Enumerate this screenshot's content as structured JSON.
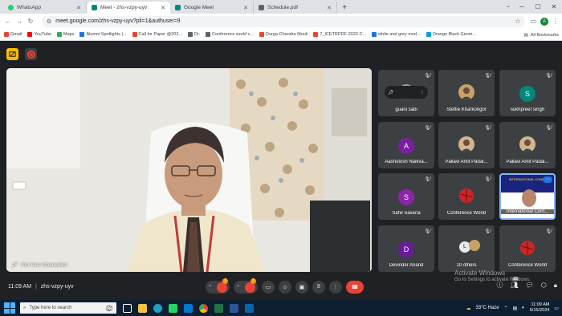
{
  "browser": {
    "tabs": [
      {
        "title": "WhatsApp",
        "color": "#25d366",
        "active": false
      },
      {
        "title": "Meet - zhs-vzpy-uyv",
        "color": "#00897b",
        "active": true
      },
      {
        "title": "Google Meet",
        "color": "#00897b",
        "active": false
      },
      {
        "title": "Schedule.pdf",
        "color": "#5f6368",
        "active": false
      }
    ],
    "new_tab": "+",
    "url": "meet.google.com/zhs-vzpy-uyv?pli=1&authuser=9",
    "bookmarks": [
      {
        "label": "Gmail",
        "color": "#ea4335"
      },
      {
        "label": "YouTube",
        "color": "#ff0000"
      },
      {
        "label": "Maps",
        "color": "#34a853"
      },
      {
        "label": "Alumni Spotlights |...",
        "color": "#1a73e8"
      },
      {
        "label": "Call for Paper @202...",
        "color": "#ea4335"
      },
      {
        "label": "Dr.",
        "color": "#5f6368"
      },
      {
        "label": "Conference world c...",
        "color": "#5f6368"
      },
      {
        "label": "Durga Chandra Mouli",
        "color": "#ea4335"
      },
      {
        "label": "7_ICETRPDF-2023 C...",
        "color": "#ea4335"
      },
      {
        "label": "white and grey mod...",
        "color": "#1a73e8"
      },
      {
        "label": "Orange Black Geom...",
        "color": "#00a3e0"
      }
    ],
    "all_bookmarks": "All Bookmarks"
  },
  "meet": {
    "main_speaker": {
      "name": "Pro Vice-Chancellor"
    },
    "tiles": [
      {
        "name": "guani sabi",
        "type": "photo",
        "color": "#9e9e9e",
        "pinned": true
      },
      {
        "name": "Steffie Kharkongor",
        "type": "photo",
        "color": "#c8a165"
      },
      {
        "name": "sukhpreet singh",
        "type": "letter",
        "letter": "S",
        "color": "#00897b"
      },
      {
        "name": "Aashutosh Naikva...",
        "type": "letter",
        "letter": "A",
        "color": "#7b1fa2"
      },
      {
        "name": "Pallavi Amit Padal...",
        "type": "photo",
        "color": "#d4b48c"
      },
      {
        "name": "Pallavi Amit Padal...",
        "type": "photo",
        "color": "#d4b48c"
      },
      {
        "name": "Sahil Saxena",
        "type": "letter",
        "letter": "S",
        "color": "#8e24aa"
      },
      {
        "name": "Conference World",
        "type": "logo",
        "color": "#c62828"
      },
      {
        "name": "International Conf...",
        "type": "screen",
        "color": "#1a237e"
      },
      {
        "name": "Devinder Anand",
        "type": "letter",
        "letter": "D",
        "color": "#6a1b9a"
      },
      {
        "name": "10 others",
        "type": "others",
        "letter": "L",
        "color": "#5f6368"
      },
      {
        "name": "Conference World",
        "type": "logo",
        "color": "#c62828"
      }
    ],
    "screen_share_text": "INTERNATIONAL CONFE",
    "bottom": {
      "time": "11:09 AM",
      "separator": "|",
      "meeting_code": "zhs-vzpy-uyv",
      "participant_count": "22",
      "badge": "!"
    },
    "watermark": {
      "title": "Activate Windows",
      "subtitle": "Go to Settings to activate Windows."
    }
  },
  "taskbar": {
    "search_placeholder": "Type here to search",
    "weather": "33°C Haze",
    "time": "11:09 AM",
    "date": "5/15/2024"
  }
}
